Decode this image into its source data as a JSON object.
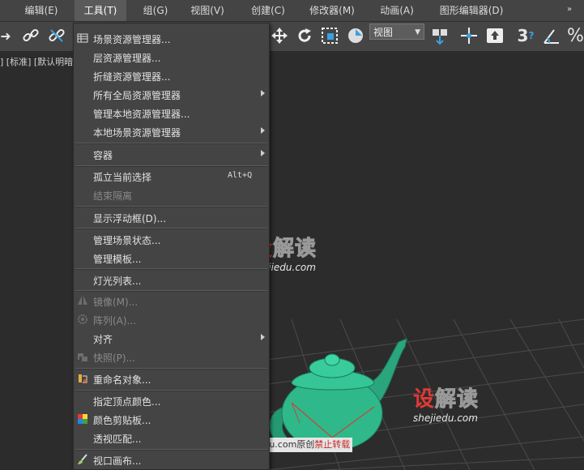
{
  "menubar": {
    "items": [
      {
        "label": "编辑(E)"
      },
      {
        "label": "工具(T)"
      },
      {
        "label": "组(G)"
      },
      {
        "label": "视图(V)"
      },
      {
        "label": "创建(C)"
      },
      {
        "label": "修改器(M)"
      },
      {
        "label": "动画(A)"
      },
      {
        "label": "图形编辑器(D)"
      }
    ],
    "active": "工具(T)",
    "overflow": "»"
  },
  "toolbar": {
    "view_dropdown": "视图",
    "number_label": "3"
  },
  "viewport": {
    "label": "] [标准] [默认明暗"
  },
  "tools_menu": {
    "items": [
      {
        "label": "场景资源管理器...",
        "icon": "table-icon"
      },
      {
        "label": "层资源管理器..."
      },
      {
        "label": "折缝资源管理器..."
      },
      {
        "label": "所有全局资源管理器",
        "submenu": true
      },
      {
        "label": "管理本地资源管理器..."
      },
      {
        "label": "本地场景资源管理器",
        "submenu": true
      },
      {
        "label": "容器",
        "submenu": true
      },
      {
        "label": "孤立当前选择",
        "shortcut": "Alt+Q"
      },
      {
        "label": "结束隔离",
        "disabled": true
      },
      {
        "label": "显示浮动框(D)..."
      },
      {
        "label": "管理场景状态..."
      },
      {
        "label": "管理模板..."
      },
      {
        "label": "灯光列表..."
      },
      {
        "label": "镜像(M)...",
        "disabled": true,
        "icon": "mirror-icon"
      },
      {
        "label": "阵列(A)...",
        "disabled": true,
        "icon": "array-icon"
      },
      {
        "label": "对齐",
        "submenu": true
      },
      {
        "label": "快照(P)...",
        "disabled": true,
        "icon": "snapshot-icon"
      },
      {
        "label": "重命名对象...",
        "icon": "rename-icon"
      },
      {
        "label": "指定顶点颜色..."
      },
      {
        "label": "颜色剪贴板...",
        "icon": "color-clipboard-icon"
      },
      {
        "label": "透视匹配..."
      },
      {
        "label": "视口画布...",
        "icon": "brush-icon"
      }
    ]
  },
  "watermark": {
    "cn": "设解读",
    "en": "shejiedu.com",
    "credit_site": "shejiedu.com原创",
    "credit_warn": "禁止转载"
  },
  "colors": {
    "menu_bg": "#444444",
    "viewport_bg": "#2c2c2c",
    "teapot": "#2fb88a",
    "watermark_red": "#e53935"
  }
}
